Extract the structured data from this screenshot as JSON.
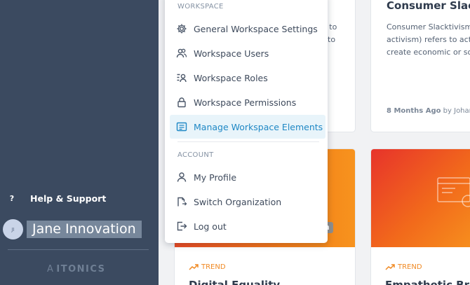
{
  "sidebar": {
    "help_label": "Help & Support",
    "help_glyph": "?",
    "user_initials": "JI",
    "user_name": "Jane Innovation",
    "logo_text": "ITONICS",
    "logo_mark": "A"
  },
  "cards": {
    "right_top": {
      "title": "Consumer Slack",
      "desc_lines": [
        "Consumer Slacktivism",
        "activism) refers to act",
        "create economic or so"
      ],
      "meta_time": "8 Months Ago",
      "meta_by": "by Johann"
    },
    "left_top_frag": [
      "e to",
      "r to"
    ],
    "left_bot": {
      "pill": "ch",
      "trend": "TREND",
      "title": "Digital Equality"
    },
    "right_bot": {
      "trend": "TREND",
      "title": "Empathetic Brand"
    }
  },
  "menu": {
    "workspace_label": "WORKSPACE",
    "account_label": "ACCOUNT",
    "items": [
      {
        "label": "General Workspace Settings",
        "icon": "gear-icon"
      },
      {
        "label": "Workspace Users",
        "icon": "users-icon"
      },
      {
        "label": "Workspace Roles",
        "icon": "roles-icon"
      },
      {
        "label": "Workspace Permissions",
        "icon": "lock-icon"
      },
      {
        "label": "Manage Workspace Elements",
        "icon": "elements-icon",
        "active": true
      },
      {
        "label": "My Profile",
        "icon": "user-icon"
      },
      {
        "label": "Switch Organization",
        "icon": "switch-org-icon"
      },
      {
        "label": "Log out",
        "icon": "logout-icon"
      }
    ]
  },
  "colors": {
    "sidebar": "#3b4a60",
    "accent": "#1f88c5",
    "trend": "#f08a24",
    "hero": "#f26a1b"
  }
}
